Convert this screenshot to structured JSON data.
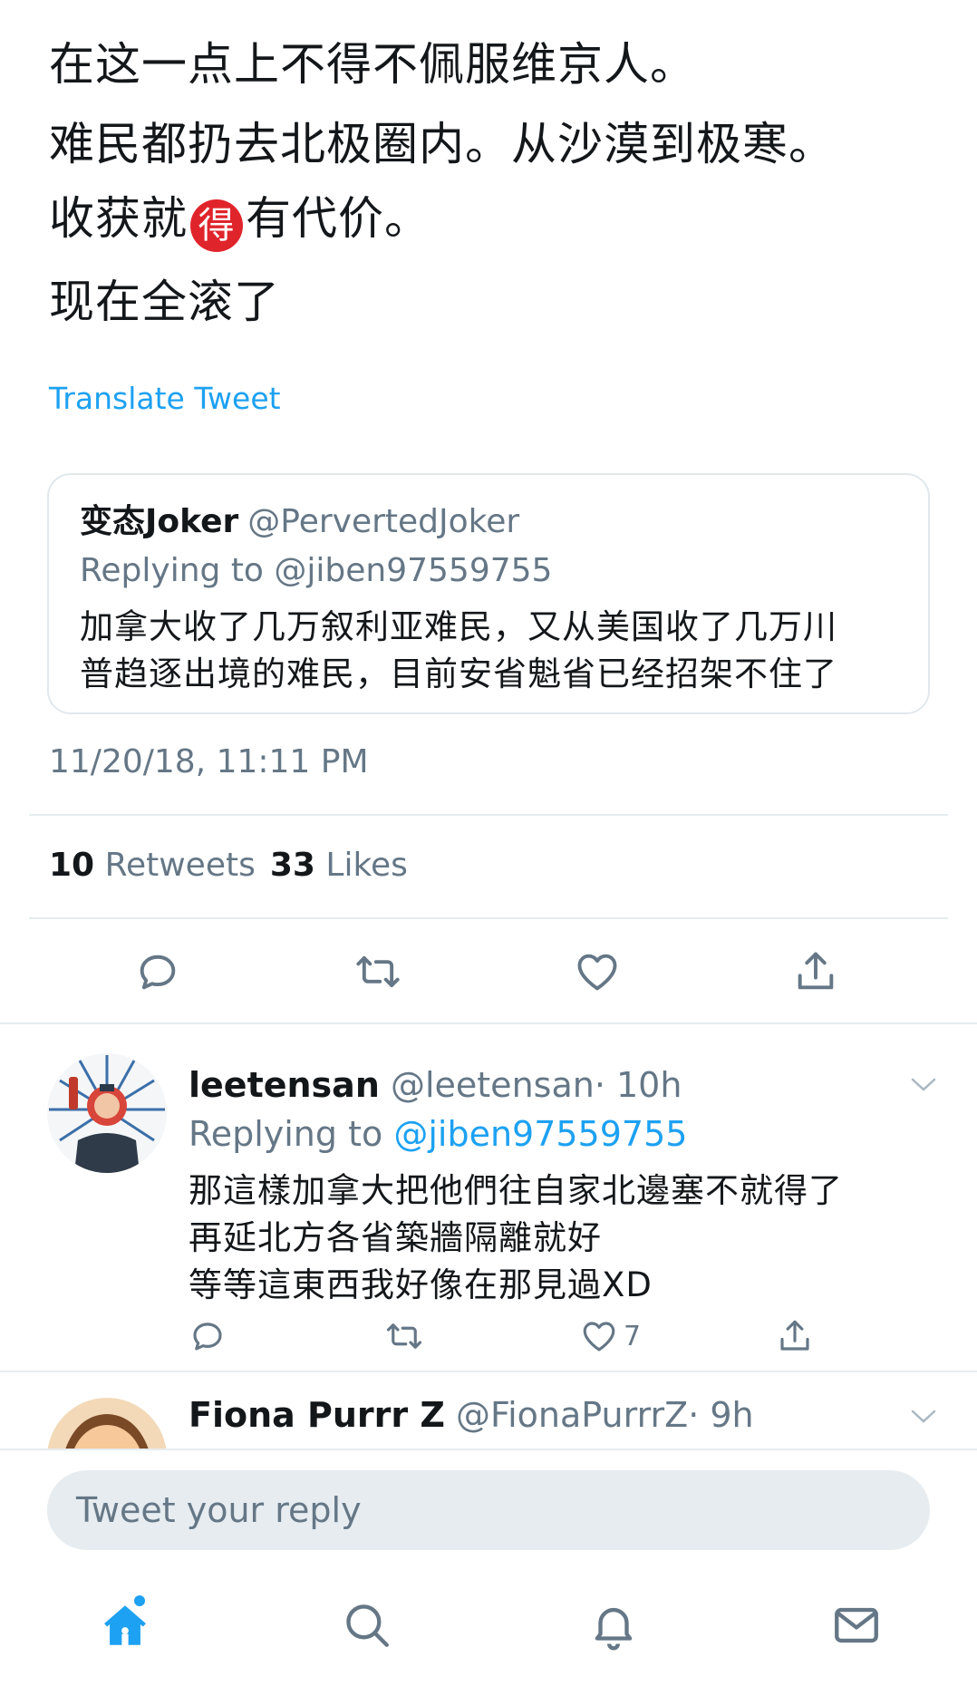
{
  "tweet": {
    "lines": [
      "在这一点上不得不佩服维京人。",
      "难民都扔去北极圈内。从沙漠到极寒。",
      "收获就",
      "有代价。",
      "现在全滚了"
    ],
    "badge_glyph": "得",
    "translate_label": "Translate Tweet",
    "timestamp": "11/20/18, 11:11 PM",
    "stats": {
      "retweets_count": "10",
      "retweets_label": "Retweets",
      "likes_count": "33",
      "likes_label": "Likes"
    }
  },
  "quoted_tweet": {
    "name": "变态Joker",
    "handle": "@PervertedJoker",
    "replying_to": "Replying to @jiben97559755",
    "text_lines": [
      "加拿大收了几万叙利亚难民，又从美国收了几万川",
      "普趋逐出境的难民，目前安省魁省已经招架不住了"
    ]
  },
  "replies": [
    {
      "name": "leetensan",
      "handle": "@leetensan",
      "time": "· 10h",
      "replying_prefix": "Replying to",
      "replying_mention": "@jiben97559755",
      "text_lines": [
        "那這樣加拿大把他們往自家北邊塞不就得了",
        "再延北方各省築牆隔離就好",
        "等等這東西我好像在那見過XD"
      ],
      "like_count": "7"
    },
    {
      "name": "Fiona Purrr Z",
      "handle": "@FionaPurrrZ",
      "time": "· 9h"
    }
  ],
  "composer": {
    "placeholder": "Tweet your reply"
  },
  "icons": {
    "reply": "reply-icon",
    "retweet": "retweet-icon",
    "like": "heart-icon",
    "share": "share-icon",
    "home": "home-icon",
    "search": "search-icon",
    "notifications": "bell-icon",
    "messages": "mail-icon"
  },
  "colors": {
    "accent": "#1da1f2",
    "text": "#14171a",
    "muted": "#657786",
    "divider": "#e6ecf0",
    "badge": "#e0242b"
  }
}
